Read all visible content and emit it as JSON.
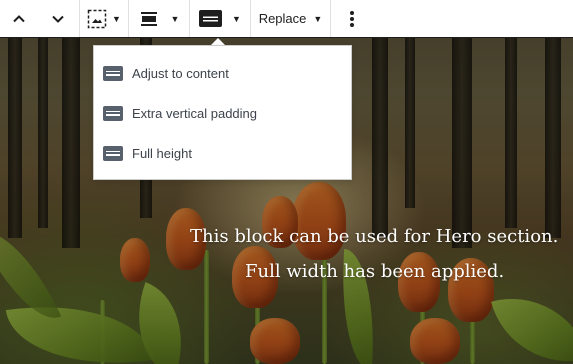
{
  "toolbar": {
    "move_up_label": "Move up",
    "move_down_label": "Move down",
    "replace_label": "Replace",
    "more_options_label": "More options"
  },
  "height_menu": {
    "items": [
      {
        "label": "Adjust to content",
        "icon": "height-icon"
      },
      {
        "label": "Extra vertical padding",
        "icon": "height-icon"
      },
      {
        "label": "Full height",
        "icon": "height-icon"
      }
    ]
  },
  "hero": {
    "line_1": "This block can be used for Hero section.",
    "line_2": "Full width has been applied."
  },
  "colors": {
    "toolbar_bg": "#ffffff",
    "toolbar_border": "#1e1e1e",
    "icon": "#1e1e1e",
    "menu_icon": "#56616b",
    "menu_text": "#3c434a",
    "hero_text": "#ffffff"
  }
}
